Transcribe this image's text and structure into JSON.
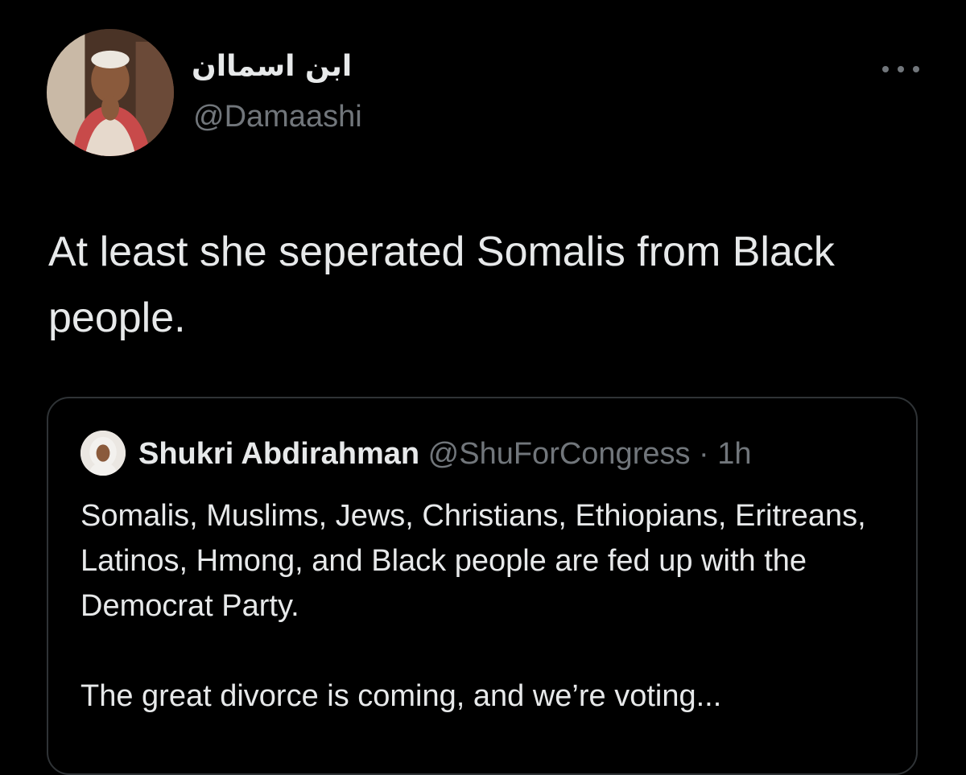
{
  "author": {
    "display_name": "ابن اسماان",
    "handle": "@Damaashi",
    "avatar_icon": "profile-photo"
  },
  "more_icon": "ellipsis-icon",
  "tweet": {
    "text": "At least she seperated Somalis from Black people."
  },
  "quoted_tweet": {
    "author_name": "Shukri Abdirahman",
    "handle": "@ShuForCongress",
    "separator": "·",
    "time": "1h",
    "paragraphs": [
      "Somalis, Muslims, Jews, Christians, Ethiopians, Eritreans, Latinos, Hmong, and Black people are fed up with the Democrat Party.",
      "The great divorce is coming, and we’re voting..."
    ]
  },
  "colors": {
    "background": "#000000",
    "text_primary": "#e7e9ea",
    "text_secondary": "#71767b",
    "border": "#2f3336"
  }
}
